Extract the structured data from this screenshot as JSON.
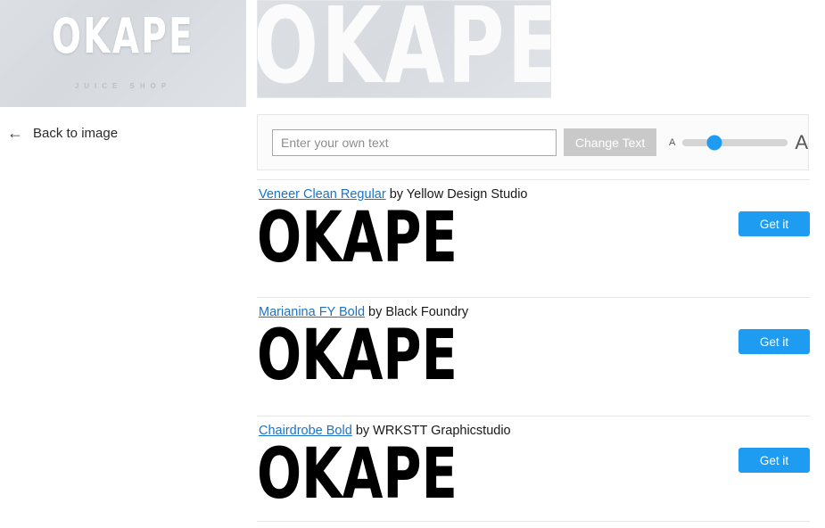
{
  "thumbnail": {
    "wordmark": "OKAPE",
    "subtitle": "JUICE SHOP"
  },
  "back_link": {
    "icon": "arrow-left-icon",
    "arrow_glyph": "←",
    "label": "Back to image"
  },
  "preview": {
    "wordmark": "OKAPE"
  },
  "toolbar": {
    "input_placeholder": "Enter your own text",
    "input_value": "",
    "change_text_label": "Change Text",
    "slider": {
      "small_label": "A",
      "large_label": "A",
      "value_percent": 30
    }
  },
  "colors": {
    "accent_blue": "#1e9cf2",
    "link_blue": "#1a73c8",
    "button_disabled_gray": "#c9c9c9",
    "divider_gray": "#e6e6e6",
    "preview_bg_gray": "#d7dbdf"
  },
  "fonts": [
    {
      "name": "Veneer Clean Regular",
      "by": " by Yellow Design Studio",
      "sample": "OKAPE",
      "get_label": "Get it"
    },
    {
      "name": "Marianina FY Bold",
      "by": " by Black Foundry",
      "sample": "OKAPE",
      "get_label": "Get it"
    },
    {
      "name": "Chairdrobe Bold",
      "by": " by WRKSTT Graphicstudio",
      "sample": "OKAPE",
      "get_label": "Get it"
    }
  ]
}
